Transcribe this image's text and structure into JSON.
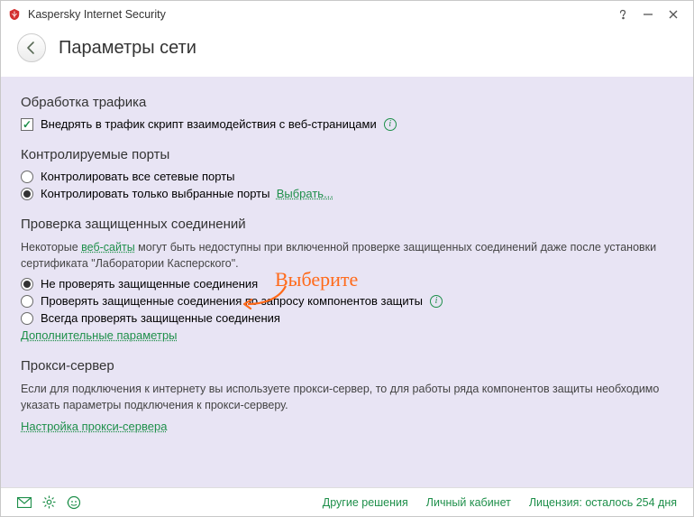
{
  "titlebar": {
    "app_name": "Kaspersky Internet Security"
  },
  "header": {
    "title": "Параметры сети"
  },
  "traffic": {
    "section": "Обработка трафика",
    "inject_label": "Внедрять в трафик скрипт взаимодействия с веб-страницами"
  },
  "ports": {
    "section": "Контролируемые порты",
    "opt_all": "Контролировать все сетевые порты",
    "opt_selected": "Контролировать только выбранные порты",
    "select_link": "Выбрать..."
  },
  "ssl": {
    "section": "Проверка защищенных соединений",
    "desc_prefix": "Некоторые ",
    "desc_link": "веб-сайты",
    "desc_suffix": " могут быть недоступны при включенной проверке защищенных соединений даже после установки сертификата \"Лаборатории Касперского\".",
    "opt_none": "Не проверять защищенные соединения",
    "opt_ondemand": "Проверять защищенные соединения по запросу компонентов защиты",
    "opt_always": "Всегда проверять защищенные соединения",
    "extra_link": "Дополнительные параметры"
  },
  "proxy": {
    "section": "Прокси-сервер",
    "desc": "Если для подключения к интернету вы используете прокси-сервер, то для работы ряда компонентов защиты необходимо указать параметры подключения к прокси-серверу.",
    "link": "Настройка прокси-сервера"
  },
  "annotation": {
    "text": "Выберите"
  },
  "footer": {
    "other": "Другие решения",
    "account": "Личный кабинет",
    "license": "Лицензия: осталось 254 дня"
  }
}
